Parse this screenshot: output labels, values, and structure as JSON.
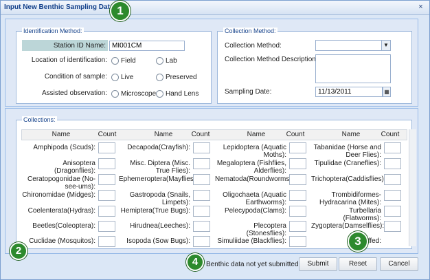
{
  "window": {
    "title": "Input New Benthic Sampling Data",
    "close_glyph": "×"
  },
  "callouts": {
    "c1": "1",
    "c2": "2",
    "c3": "3",
    "c4": "4"
  },
  "identification": {
    "legend": "Identification Method:",
    "station_label": "Station ID Name:",
    "station_value": "MI001CM",
    "location_label": "Location of identification:",
    "location_options": [
      "Field",
      "Lab"
    ],
    "condition_label": "Condition of sample:",
    "condition_options": [
      "Live",
      "Preserved"
    ],
    "assisted_label": "Assisted observation:",
    "assisted_options": [
      "Microscope",
      "Hand Lens"
    ]
  },
  "collection": {
    "legend": "Collection Method:",
    "method_label": "Collection Method:",
    "method_value": "",
    "desc_label": "Collection Method Description:",
    "date_label": "Sampling Date:",
    "date_value": "11/13/2011"
  },
  "collections": {
    "legend": "Collections:",
    "header_name": "Name",
    "header_count": "Count",
    "col1": [
      "Amphipoda (Scuds):",
      "Anisoptera (Dragonflies):",
      "Ceratopogonidae (No-see-ums):",
      "Chironomidae (Midges):",
      "Coelenterata(Hydras):",
      "Beetles(Coleoptera):",
      "Cuclidae (Mosquitos):"
    ],
    "col2": [
      "Decapoda(Crayfish):",
      "Misc. Diptera (Misc. True Flies):",
      "Ephemeroptera(Mayflies):",
      "Gastropoda (Snails, Limpets):",
      "Hemiptera(True Bugs):",
      "Hirudnea(Leeches):",
      "Isopoda (Sow Bugs):"
    ],
    "col3": [
      "Lepidoptera (Aquatic Moths):",
      "Megaloptera (Fishflies, Alderflies):",
      "Nematoda(Roundworms):",
      "Oligochaeta (Aquatic Earthworms):",
      "Pelecypoda(Clams):",
      "Plecoptera (Stonesflies):",
      "Simuliidae (Blackflies):"
    ],
    "col4": [
      "Tabanidae (Horse and Deer Flies):",
      "Tipulidae (Craneflies):",
      "Trichoptera(Caddisflies):",
      "Trombidiformes-Hydracarina (Mites):",
      "Turbellaria (Flatworms):",
      "Zygoptera(Damselflies):",
      "ffed:"
    ]
  },
  "footer": {
    "status": "Benthic data not yet submitted.",
    "submit": "Submit",
    "reset": "Reset",
    "cancel": "Cancel"
  }
}
